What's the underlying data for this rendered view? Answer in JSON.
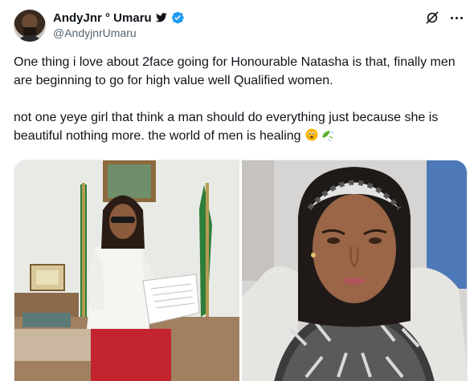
{
  "tweet": {
    "display_name": "AndyJnr ° Umaru",
    "handle": "@AndyjnrUmaru",
    "paragraph_1": "One thing i love about 2face going for Honourable Natasha is that, finally men are beginning to go for high value well Qualified women.",
    "paragraph_2": "not one yeye girl that think a man should do everything just because she is beautiful nothing more. the world of men is healing",
    "emojis": [
      "face-holding-back-tears-icon",
      "leaf-fluttering-in-wind-icon"
    ]
  },
  "icons": {
    "bird": "bird-icon",
    "verified": "verified-badge-icon",
    "grok": "grok-icon",
    "more": "more-icon"
  },
  "colors": {
    "text_primary": "#0f1419",
    "text_secondary": "#536471",
    "verified_blue": "#1d9bf0"
  },
  "media": {
    "images": [
      "photo-woman-reading-paper",
      "photo-woman-headscarf-portrait"
    ]
  }
}
